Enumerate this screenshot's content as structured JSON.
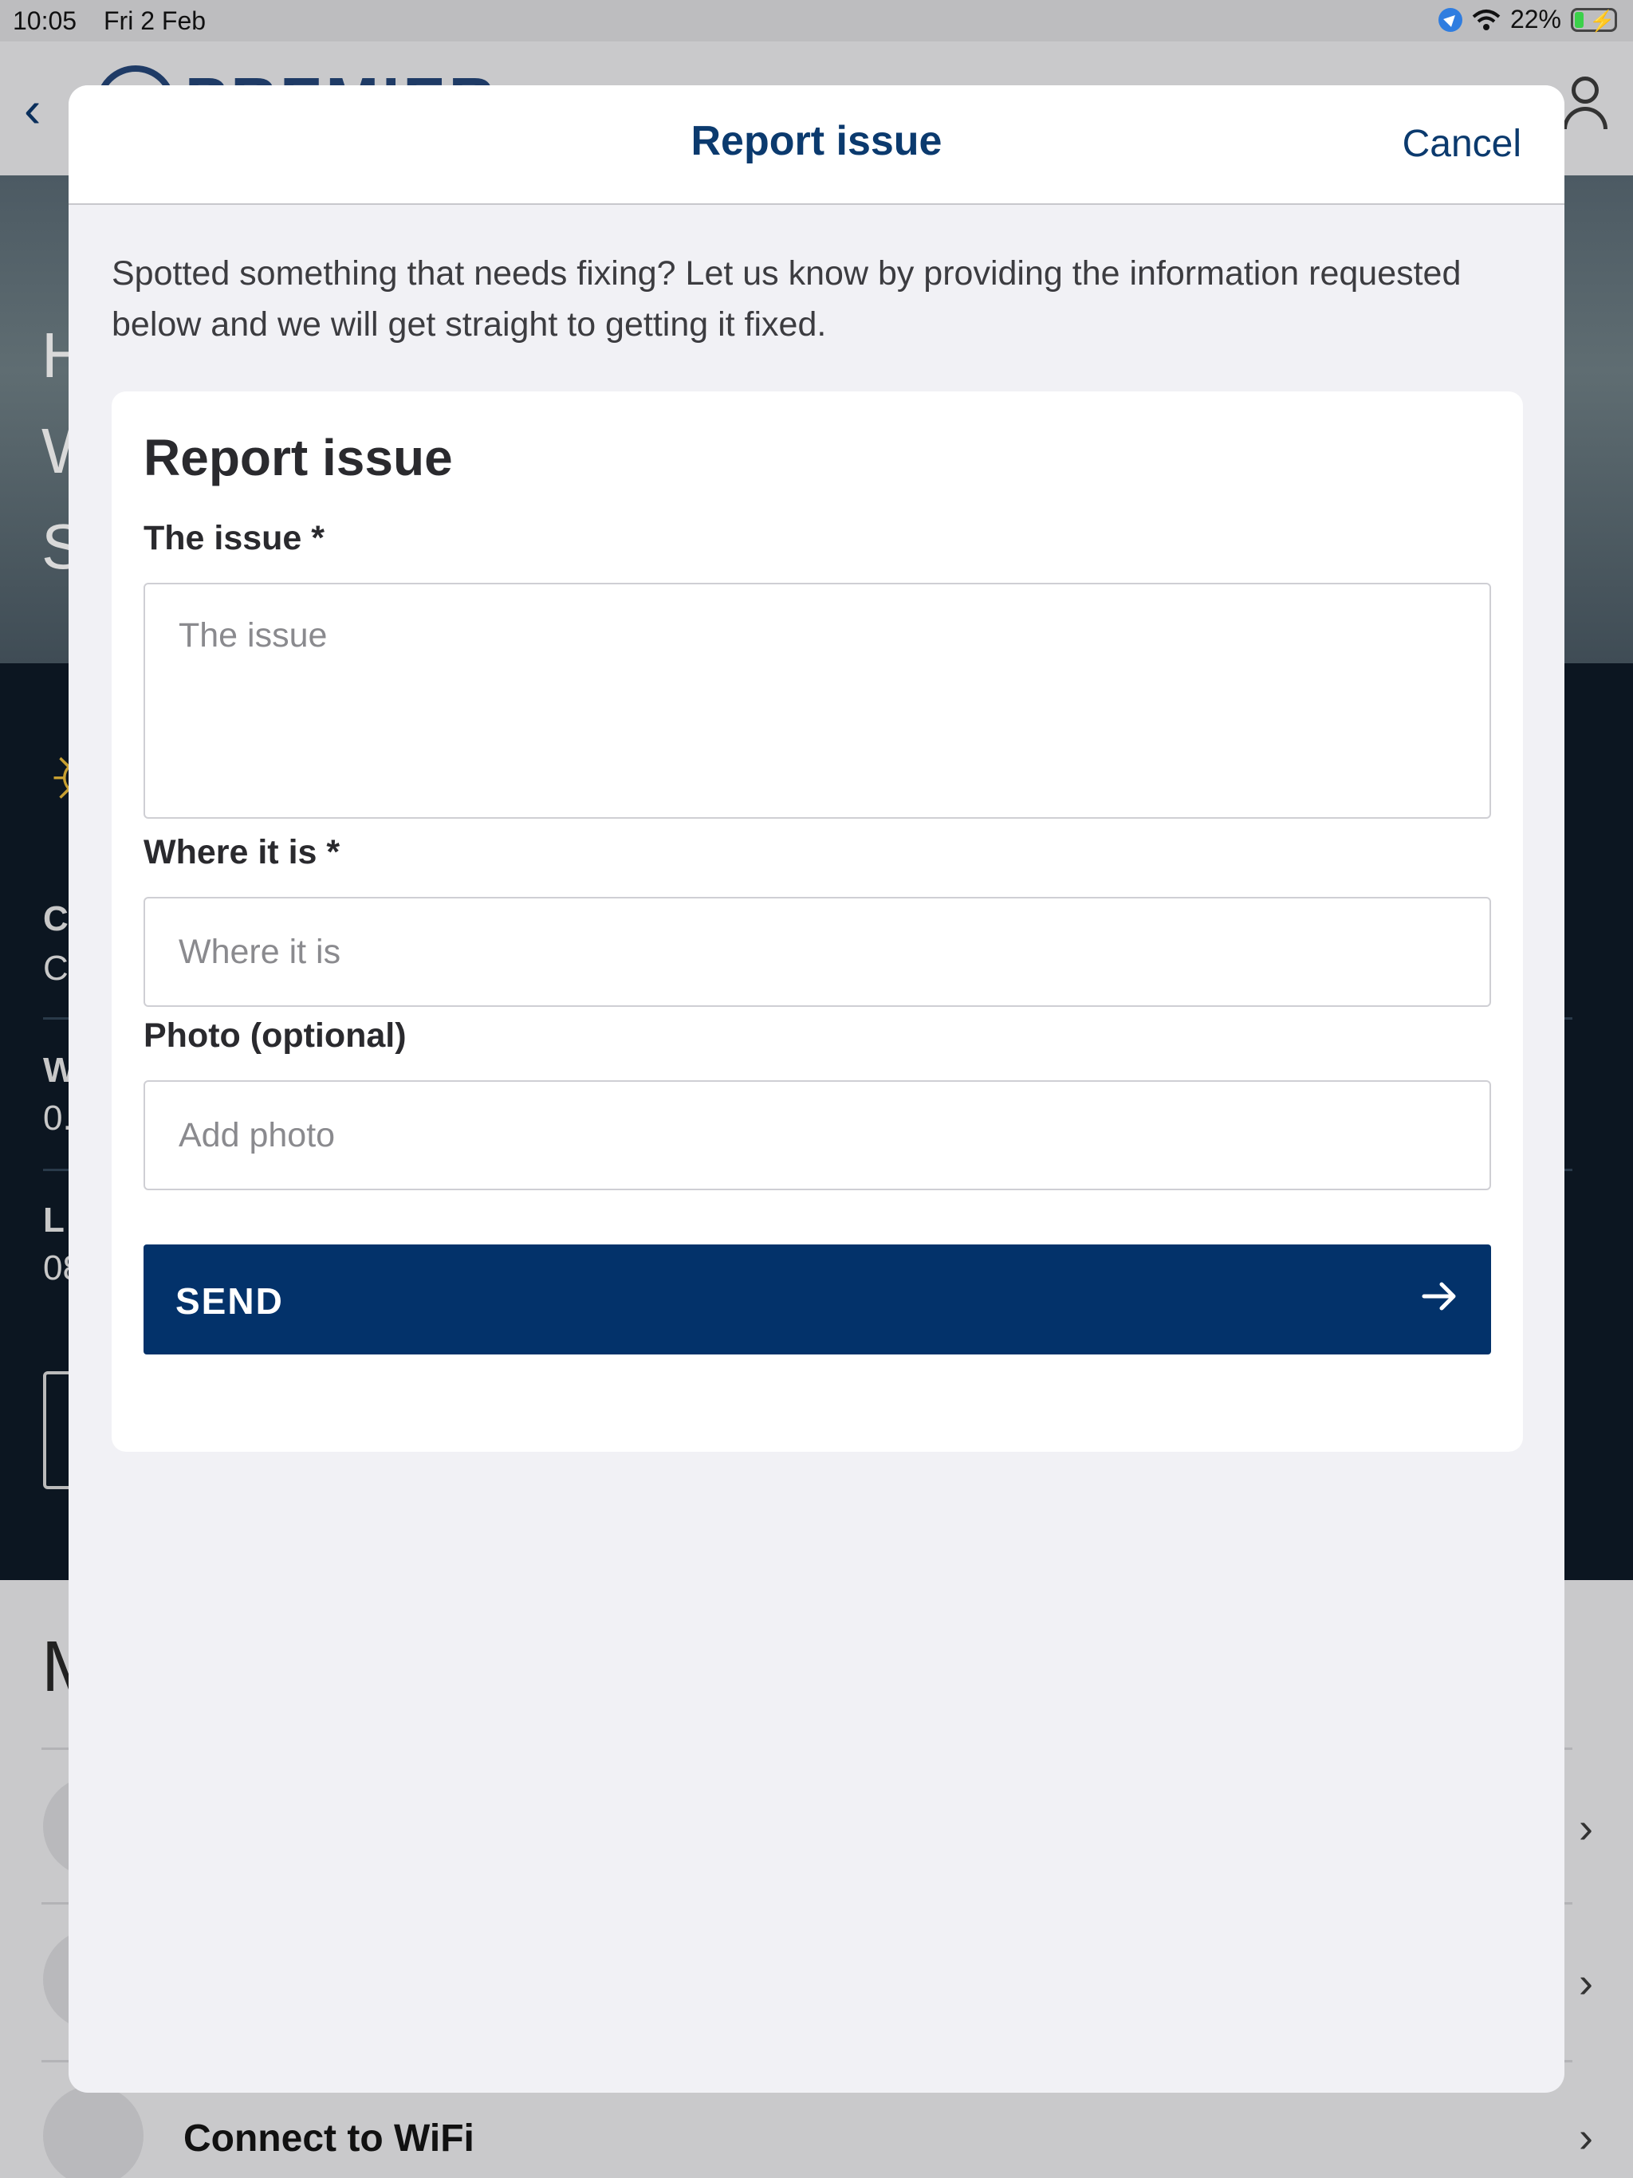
{
  "status_bar": {
    "time": "10:05",
    "date": "Fri 2 Feb",
    "battery_percent": "22%",
    "battery_level": 0.22
  },
  "background": {
    "brand": "PREMIER",
    "hero_letters": [
      "H",
      "W",
      "S"
    ],
    "rows": [
      {
        "title": "C",
        "value": "C"
      },
      {
        "title": "W",
        "value": "0."
      },
      {
        "title": "L",
        "value": "08"
      }
    ],
    "section_letter": "M",
    "wifi_item": "Connect to WiFi"
  },
  "modal": {
    "title": "Report issue",
    "cancel_label": "Cancel",
    "intro_text": "Spotted something that needs fixing? Let us know by providing the information requested below and we will get straight to getting it fixed.",
    "form": {
      "title": "Report issue",
      "issue_label": "The issue *",
      "issue_placeholder": "The issue",
      "issue_value": "",
      "location_label": "Where it is *",
      "location_placeholder": "Where it is",
      "location_value": "",
      "photo_label": "Photo (optional)",
      "photo_placeholder": "Add photo",
      "send_label": "SEND"
    }
  },
  "colors": {
    "accent": "#03326a",
    "title_blue": "#0b3a6e",
    "modal_bg": "#f1f1f5",
    "card_bg": "#ffffff"
  }
}
